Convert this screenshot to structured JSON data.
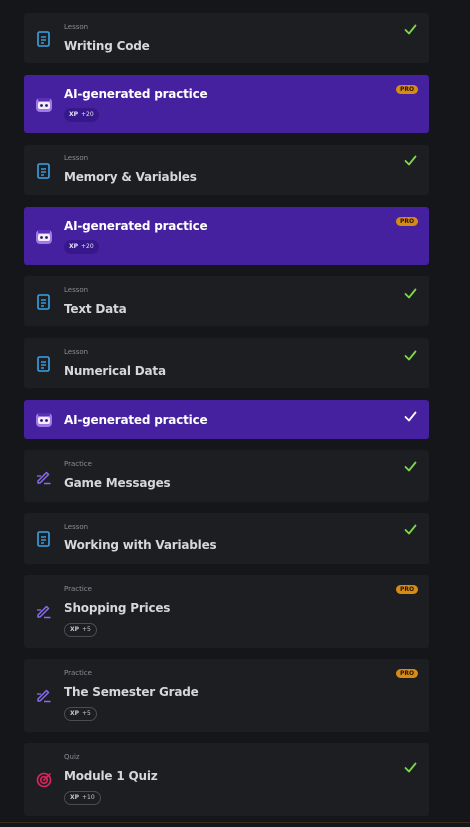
{
  "items": [
    {
      "kind": "Lesson",
      "title": "Writing Code",
      "icon": "lesson-doc-icon",
      "completed": true
    },
    {
      "kind": "",
      "title": "AI-generated practice",
      "icon": "robot-avatar-icon",
      "pro": "PRO",
      "xp_label": "XP",
      "xp_value": "+20"
    },
    {
      "kind": "Lesson",
      "title": "Memory & Variables",
      "icon": "lesson-doc-icon",
      "completed": true
    },
    {
      "kind": "",
      "title": "AI-generated practice",
      "icon": "robot-avatar-icon",
      "pro": "PRO",
      "xp_label": "XP",
      "xp_value": "+20"
    },
    {
      "kind": "Lesson",
      "title": "Text Data",
      "icon": "lesson-doc-icon",
      "completed": true
    },
    {
      "kind": "Lesson",
      "title": "Numerical Data",
      "icon": "lesson-doc-icon",
      "completed": true
    },
    {
      "kind": "",
      "title": "AI-generated practice",
      "icon": "robot-avatar-icon",
      "completed": true
    },
    {
      "kind": "Practice",
      "title": "Game Messages",
      "icon": "practice-pencil-icon",
      "completed": true
    },
    {
      "kind": "Lesson",
      "title": "Working with Variables",
      "icon": "lesson-doc-icon",
      "completed": true
    },
    {
      "kind": "Practice",
      "title": "Shopping Prices",
      "icon": "practice-pencil-icon",
      "pro": "PRO",
      "xp_label": "XP",
      "xp_value": "+5"
    },
    {
      "kind": "Practice",
      "title": "The Semester Grade",
      "icon": "practice-pencil-icon",
      "pro": "PRO",
      "xp_label": "XP",
      "xp_value": "+5"
    },
    {
      "kind": "Quiz",
      "title": "Module 1 Quiz",
      "icon": "quiz-target-icon",
      "completed": true,
      "xp_label": "XP",
      "xp_value": "+10"
    }
  ],
  "colors": {
    "background": "#151619",
    "card": "#1d1e22",
    "ai_card": "#4521a0",
    "check": "#7dd94a",
    "pro_badge": "#d78a14",
    "lesson_icon": "#3aa3e8",
    "practice_icon": "#8a6af0",
    "quiz_icon": "#e0245e"
  }
}
